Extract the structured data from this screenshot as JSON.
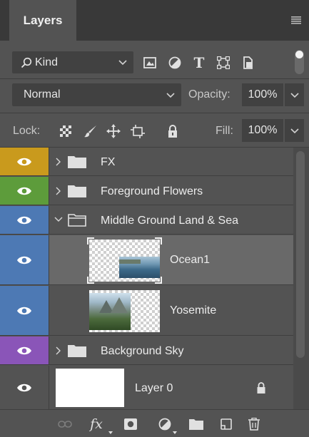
{
  "panel": {
    "tab_label": "Layers",
    "kind_filter": {
      "value": "Kind"
    },
    "filter_icons": [
      "pixel-layer-filter-icon",
      "adjustment-layer-filter-icon",
      "type-layer-filter-icon",
      "shape-layer-filter-icon",
      "smart-object-filter-icon"
    ],
    "type_filter_glyph": "T",
    "blend_mode": "Normal",
    "opacity": {
      "label": "Opacity:",
      "value": "100%"
    },
    "lock": {
      "label": "Lock:"
    },
    "fill": {
      "label": "Fill:",
      "value": "100%"
    }
  },
  "layers": [
    {
      "name": "FX",
      "kind": "group",
      "expanded": false,
      "color": "#c99a1d"
    },
    {
      "name": "Foreground Flowers",
      "kind": "group",
      "expanded": false,
      "color": "#5d9c3b"
    },
    {
      "name": "Middle Ground Land & Sea",
      "kind": "group",
      "expanded": true,
      "color": "#4d79b4"
    },
    {
      "name": "Ocean1",
      "kind": "image",
      "selected": true,
      "color": "#4d79b4"
    },
    {
      "name": "Yosemite",
      "kind": "image",
      "color": "#4d79b4"
    },
    {
      "name": "Background Sky",
      "kind": "group",
      "expanded": false,
      "color": "#8a55b8"
    },
    {
      "name": "Layer 0",
      "kind": "locked-fill",
      "locked": true,
      "color": "#535353"
    }
  ],
  "toolbar": {
    "fx_label": "fx",
    "icons": [
      "link-layers-icon",
      "layer-style-fx-icon",
      "add-mask-icon",
      "adjustment-layer-icon",
      "new-group-icon",
      "new-layer-icon",
      "delete-layer-icon"
    ]
  },
  "colors": {
    "panel_bg": "#535353",
    "tab_bar": "#393939",
    "selected_row": "#696969",
    "yellow_label": "#c99a1d",
    "green_label": "#5d9c3b",
    "blue_label": "#4d79b4",
    "violet_label": "#8a55b8"
  }
}
